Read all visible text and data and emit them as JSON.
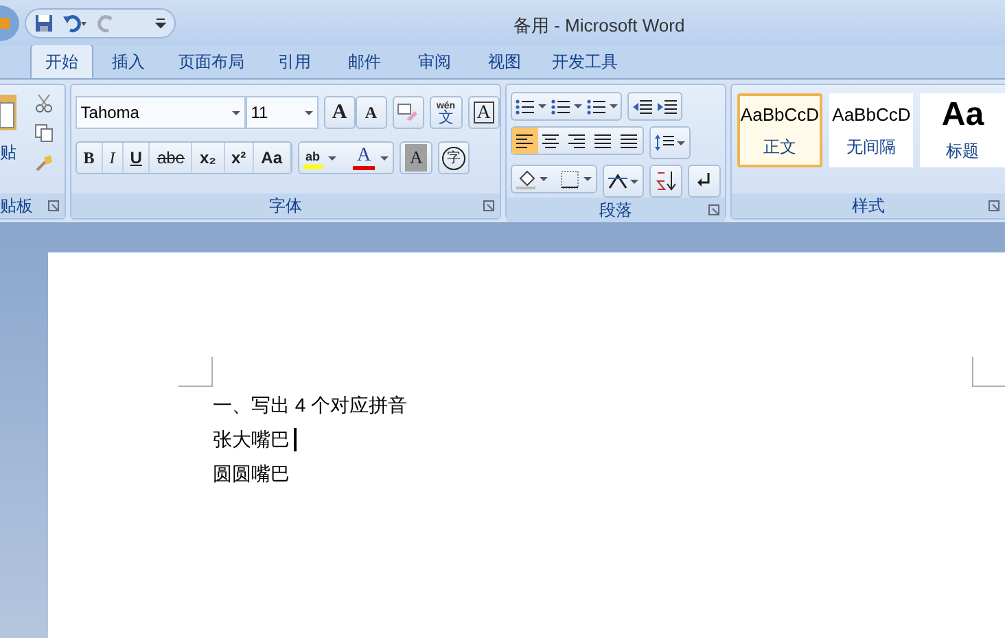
{
  "window": {
    "title": "备用 - Microsoft Word"
  },
  "tabs": [
    {
      "label": "开始",
      "selected": true
    },
    {
      "label": "插入",
      "selected": false
    },
    {
      "label": "页面布局",
      "selected": false
    },
    {
      "label": "引用",
      "selected": false
    },
    {
      "label": "邮件",
      "selected": false
    },
    {
      "label": "审阅",
      "selected": false
    },
    {
      "label": "视图",
      "selected": false
    },
    {
      "label": "开发工具",
      "selected": false
    }
  ],
  "clipboard": {
    "paste_label": "贴",
    "group_label": "贴板"
  },
  "font": {
    "name": "Tahoma",
    "size": "11",
    "top_buttons": [
      "A",
      "A"
    ],
    "pinyin": [
      "wén",
      "文"
    ],
    "border_label": "A",
    "format_buttons": [
      {
        "label": "B",
        "kind": "bold"
      },
      {
        "label": "I",
        "kind": "italic"
      },
      {
        "label": "U",
        "kind": "underline"
      },
      {
        "label": "abe",
        "kind": "strike"
      },
      {
        "label": "x₂",
        "kind": "plain"
      },
      {
        "label": "x²",
        "kind": "plain"
      },
      {
        "label": "Aa",
        "kind": "plain"
      }
    ],
    "highlight_label": "ab",
    "color_label": "A",
    "shading_label": "A",
    "enclose_label": "字",
    "group_label": "字体"
  },
  "paragraph": {
    "group_label": "段落",
    "alignments": [
      {
        "selected": true
      },
      {
        "selected": false
      },
      {
        "selected": false
      },
      {
        "selected": false
      },
      {
        "selected": false
      }
    ]
  },
  "styles": {
    "group_label": "样式",
    "items": [
      {
        "sample": "AaBbCcD",
        "name": "正文",
        "selected": true,
        "kind": "normal"
      },
      {
        "sample": "AaBbCcD",
        "name": "无间隔",
        "selected": false,
        "kind": "normal"
      },
      {
        "sample": "Aa",
        "name": "标题",
        "selected": false,
        "kind": "heading"
      }
    ]
  },
  "document": {
    "lines": [
      {
        "text": "一、写出 4 个对应拼音",
        "cursor": false
      },
      {
        "text": "张大嘴巴",
        "cursor": true
      },
      {
        "text": "圆圆嘴巴",
        "cursor": false
      }
    ]
  }
}
